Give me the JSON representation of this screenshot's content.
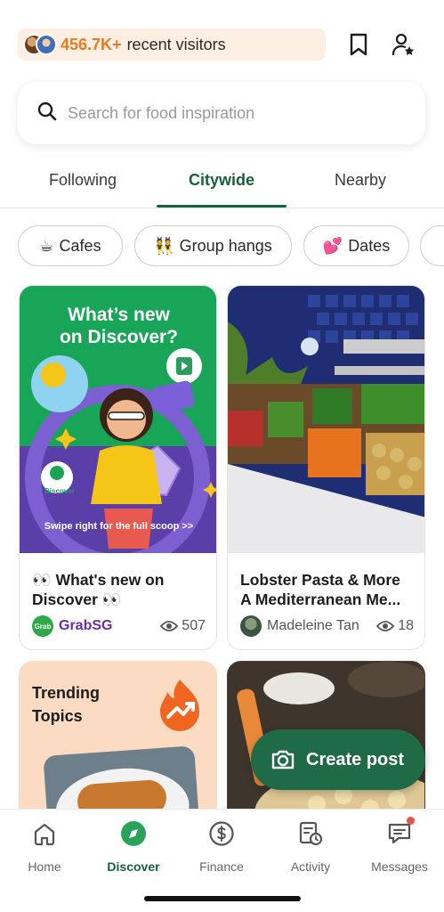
{
  "header": {
    "visitors_count": "456.7K+",
    "visitors_label": "recent visitors"
  },
  "search": {
    "placeholder": "Search for food inspiration",
    "icon": "search-icon"
  },
  "tabs": [
    {
      "label": "Following",
      "active": false
    },
    {
      "label": "Citywide",
      "active": true
    },
    {
      "label": "Nearby",
      "active": false
    }
  ],
  "chips": [
    {
      "emoji": "☕",
      "label": "Cafes"
    },
    {
      "emoji": "👯",
      "label": "Group hangs"
    },
    {
      "emoji": "💕",
      "label": "Dates"
    }
  ],
  "cards": [
    {
      "image_headline_1": "What’s new",
      "image_headline_2": "on Discover?",
      "image_footer": "Swipe right for the full scoop >>",
      "badge_text": "Discover",
      "title_line1": "👀 What's new on",
      "title_line2": "Discover 👀",
      "author": "GrabSG",
      "author_badge": "Grab",
      "views": "507"
    },
    {
      "title_line1": "Lobster Pasta & More",
      "title_line2": "A Mediterranean Me...",
      "author": "Madeleine Tan",
      "views": "18"
    },
    {
      "headline_line1": "Trending",
      "headline_line2": "Topics"
    },
    {}
  ],
  "fab": {
    "label": "Create post"
  },
  "bottom_nav": [
    {
      "label": "Home",
      "icon": "home-icon",
      "active": false
    },
    {
      "label": "Discover",
      "icon": "compass-icon",
      "active": true
    },
    {
      "label": "Finance",
      "icon": "dollar-icon",
      "active": false
    },
    {
      "label": "Activity",
      "icon": "activity-icon",
      "active": false
    },
    {
      "label": "Messages",
      "icon": "messages-icon",
      "active": false,
      "has_notification": true
    }
  ],
  "colors": {
    "brand_green": "#17613f",
    "fab_green": "#1f6a47",
    "visitors_orange": "#e87b24",
    "visitors_bg": "#fdf0e2",
    "notification_red": "#e8524a"
  }
}
